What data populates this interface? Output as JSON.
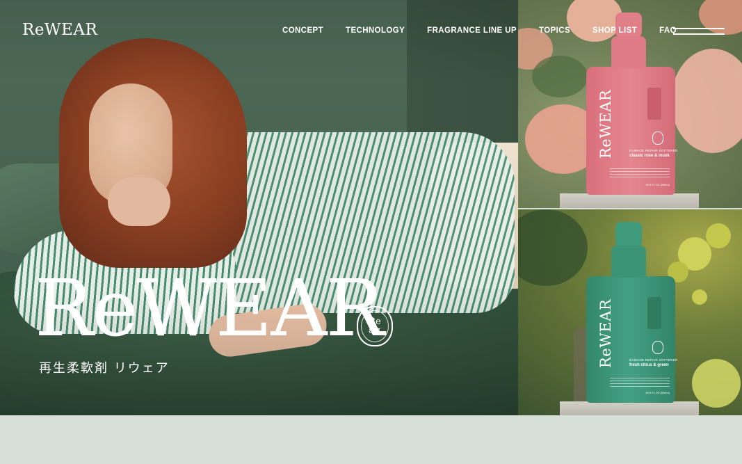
{
  "header": {
    "logo": "ReWEAR",
    "nav": [
      "CONCEPT",
      "TECHNOLOGY",
      "FRAGRANCE LINE UP",
      "TOPICS",
      "SHOP LIST",
      "FAQ"
    ],
    "menu_icon": "hamburger-icon"
  },
  "hero": {
    "logo": "ReWEAR",
    "seal_text_top": "Re",
    "seal_text_bottom": "Re",
    "tagline": "再生柔軟剤 リウェア"
  },
  "products": [
    {
      "brand": "ReWEAR",
      "subtitle": "DAMAGE REPAIR SOFTENER",
      "scent": "classic rose & musk",
      "volume": "16.9 FL OZ (500ml)",
      "color": "#e07d86",
      "background": "rose garden"
    },
    {
      "brand": "ReWEAR",
      "subtitle": "DAMAGE REPAIR SOFTENER",
      "scent": "fresh citrus & green",
      "volume": "16.9 FL OZ (500ml)",
      "color": "#3f9a7c",
      "background": "citrus grove"
    }
  ],
  "colors": {
    "hero_green": "#486451",
    "band": "#d6e0d8",
    "rose_bottle": "#e07d86",
    "green_bottle": "#3f9a7c",
    "text": "#ffffff"
  }
}
